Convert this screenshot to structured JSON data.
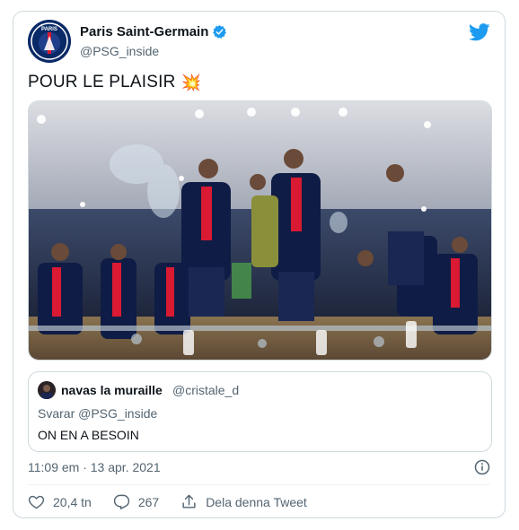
{
  "author": {
    "display_name": "Paris Saint-Germain",
    "handle": "@PSG_inside",
    "verified": true
  },
  "tweet": {
    "text": "POUR LE PLAISIR",
    "emoji": "💥"
  },
  "media": {
    "alt": "PSG players celebrating in the locker room"
  },
  "quoted_tweet": {
    "display_name": "navas la muraille",
    "handle": "@cristale_d",
    "reply_prefix": "Svarar",
    "reply_to": "@PSG_inside",
    "text": "ON EN A BESOIN"
  },
  "timestamp": "11:09 em · 13 apr. 2021",
  "actions": {
    "likes": "20,4 tn",
    "replies": "267",
    "share_label": "Dela denna Tweet"
  },
  "colors": {
    "brand": "#1d9bf0",
    "text": "#0f1419",
    "secondary": "#536471",
    "border": "#cfd9de"
  },
  "icons": [
    "psg-logo-avatar",
    "verified-badge-icon",
    "twitter-bird-icon",
    "info-icon",
    "heart-icon",
    "reply-icon",
    "share-icon"
  ]
}
